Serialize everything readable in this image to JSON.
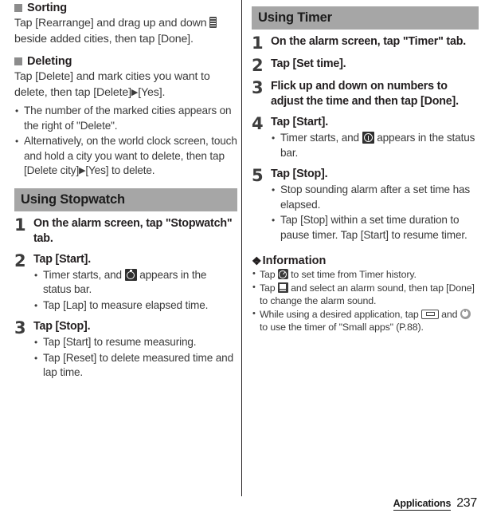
{
  "page": {
    "footer_label": "Applications",
    "page_number": "237"
  },
  "left_column": {
    "sorting": {
      "heading": "Sorting",
      "paragraph_before_icon": "Tap [Rearrange] and drag up and down",
      "paragraph_after_icon": "beside added cities, then tap [Done]."
    },
    "deleting": {
      "heading": "Deleting",
      "paragraph_part1": "Tap [Delete] and mark cities you want to delete, then tap [Delete]",
      "paragraph_arrow": "▶",
      "paragraph_part2": "[Yes].",
      "bullets": [
        "The number of the marked cities appears on the right of \"Delete\".",
        "Alternatively, on the world clock screen, touch and hold a city you want to delete, then tap [Delete city]",
        "[Yes] to delete."
      ]
    },
    "stopwatch_section": {
      "title": "Using Stopwatch",
      "steps": [
        {
          "number": "1",
          "title": "On the alarm screen, tap \"Stopwatch\" tab.",
          "bullets": []
        },
        {
          "number": "2",
          "title": "Tap [Start].",
          "bullets": [
            {
              "text_before": "Timer starts, and",
              "icon": "stopwatch-icon",
              "text_after": "appears in the status bar."
            },
            {
              "text_before": "Tap [Lap] to measure elapsed time.",
              "icon": "",
              "text_after": ""
            }
          ]
        },
        {
          "number": "3",
          "title": "Tap [Stop].",
          "bullets": [
            {
              "text_before": "Tap [Start] to resume measuring.",
              "icon": "",
              "text_after": ""
            },
            {
              "text_before": "Tap [Reset] to delete measured time and lap time.",
              "icon": "",
              "text_after": ""
            }
          ]
        }
      ]
    }
  },
  "right_column": {
    "timer_section": {
      "title": "Using Timer",
      "steps": [
        {
          "number": "1",
          "title": "On the alarm screen, tap \"Timer\" tab.",
          "bullets": []
        },
        {
          "number": "2",
          "title": "Tap [Set time].",
          "bullets": []
        },
        {
          "number": "3",
          "title": "Flick up and down on numbers to adjust the time and then tap [Done].",
          "bullets": []
        },
        {
          "number": "4",
          "title": "Tap [Start].",
          "bullets": [
            {
              "text_before": "Timer starts, and",
              "icon": "timer-icon",
              "text_after": "appears in the status bar."
            }
          ]
        },
        {
          "number": "5",
          "title": "Tap [Stop].",
          "bullets": [
            {
              "text_before": "Stop sounding alarm after a set time has elapsed.",
              "icon": "",
              "text_after": ""
            },
            {
              "text_before": "Tap [Stop] within a set time duration to pause timer. Tap [Start] to resume timer.",
              "icon": "",
              "text_after": ""
            }
          ]
        }
      ]
    },
    "information": {
      "glyph": "❖",
      "heading": "Information",
      "bullets": [
        {
          "text_before": "Tap",
          "icon": "timer-history-icon",
          "text_after": "to set time from Timer history."
        },
        {
          "text_before": "Tap",
          "icon": "alarm-sound-icon",
          "text_after": "and select an alarm sound, then tap [Done] to change the alarm sound."
        },
        {
          "text_before": "While using a desired application, tap",
          "icon": "recent-apps-key-icon",
          "text_middle": "and",
          "icon2": "small-apps-timer-icon",
          "text_after": "to use the timer of \"Small apps\" (P.88)."
        }
      ]
    }
  },
  "colors": {
    "section_bar_bg": "#a6a6a6",
    "bullet_square": "#8c8c8c",
    "body_text": "#3a3a3a",
    "heading_text": "#231f20",
    "divider": "#231f20"
  }
}
